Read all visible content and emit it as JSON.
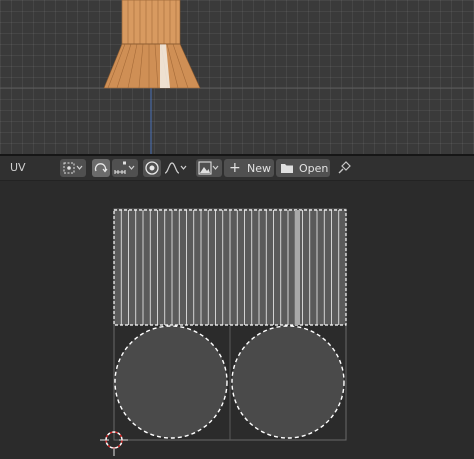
{
  "uv_header": {
    "editor_label": "UV",
    "new_label": "New",
    "open_label": "Open",
    "new_plus_glyph": "+",
    "dropdown_chevron": "⌄"
  },
  "icons": {
    "pivot": "pivot-point-icon",
    "sync": "sync-selection-icon",
    "snap": "snap-icon",
    "proportional": "proportional-edit-icon",
    "falloff": "falloff-curve-icon",
    "image": "image-browse-icon",
    "folder": "folder-icon",
    "pin": "pin-icon",
    "cursor": "2d-cursor-icon"
  },
  "colors": {
    "mesh_orange": "#d89a60",
    "selection_white": "#ffffff",
    "grid_bg": "#3a3a3a",
    "uv_face_fill": "#555555",
    "cursor_red": "#d42a2a"
  }
}
